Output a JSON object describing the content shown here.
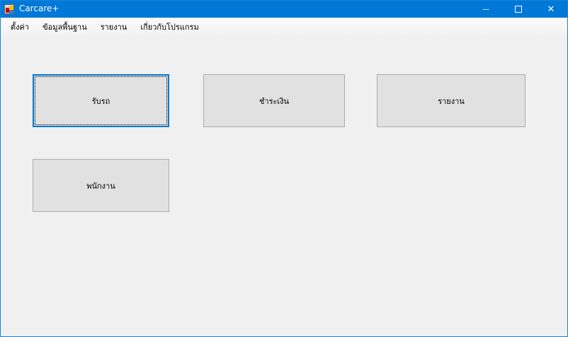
{
  "window": {
    "title": "Carcare+"
  },
  "menu": [
    {
      "label": "ตั้งค่า"
    },
    {
      "label": "ข้อมูลพื้นฐาน"
    },
    {
      "label": "รายงาน"
    },
    {
      "label": "เกี่ยวกับโปรแกรม"
    }
  ],
  "buttons": {
    "receive_car": "รับรถ",
    "payment": "ชำระเงิน",
    "report": "รายงาน",
    "employee": "พนักงาน"
  },
  "controls": {
    "minimize": "—",
    "maximize": "☐",
    "close": "✕"
  }
}
